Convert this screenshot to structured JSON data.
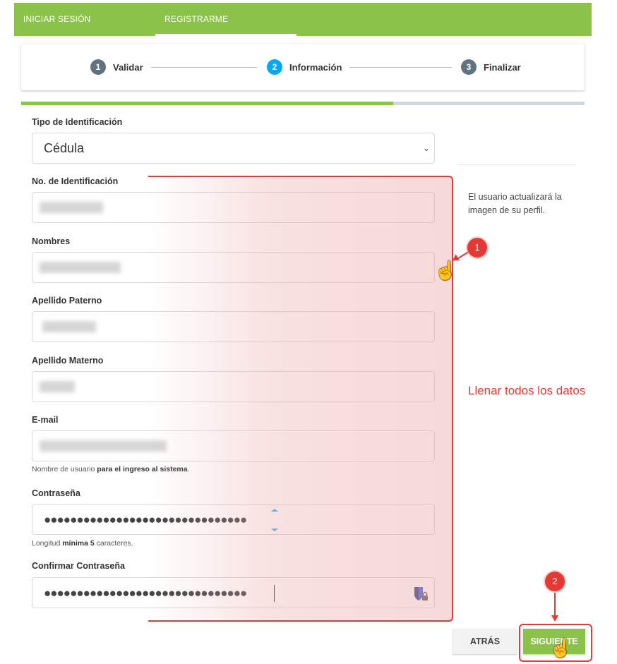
{
  "tabs": {
    "login": "INICIAR SESIÓN",
    "register": "REGISTRARME"
  },
  "stepper": [
    {
      "number": "1",
      "label": "Validar"
    },
    {
      "number": "2",
      "label": "Información"
    },
    {
      "number": "3",
      "label": "Finalizar"
    }
  ],
  "progress": {
    "fraction": 0.66
  },
  "form": {
    "id_type": {
      "label": "Tipo de Identificación",
      "value": "Cédula"
    },
    "id_number": {
      "label": "No. de Identificación"
    },
    "first_names": {
      "label": "Nombres"
    },
    "last_name_paternal": {
      "label": "Apellido Paterno"
    },
    "last_name_maternal": {
      "label": "Apellido Materno"
    },
    "email": {
      "label": "E-mail",
      "help_prefix": "Nombre de usuario ",
      "help_bold": "para el ingreso al sistema",
      "help_suffix": "."
    },
    "password": {
      "label": "Contraseña",
      "value": "●●●●●●●●●●●●●●●●●●●●●●●●●●●●●●●",
      "help_prefix": "Longitud ",
      "help_bold": "mínima 5",
      "help_suffix": " caracteres."
    },
    "confirm_password": {
      "label": "Confirmar Contraseña",
      "value": "●●●●●●●●●●●●●●●●●●●●●●●●●●●●●●●"
    }
  },
  "side_note": "El usuario actualizará la imagen de su perfil.",
  "annotations": {
    "badge1": "1",
    "badge2": "2",
    "fill_note": "Llenar todos los datos"
  },
  "buttons": {
    "back": "ATRÁS",
    "next": "SIGUIENTE"
  },
  "colors": {
    "brand_green": "#8bc34a",
    "step_active": "#03a9f4",
    "step_inactive": "#5f7380",
    "annotation_red": "#e53935"
  }
}
